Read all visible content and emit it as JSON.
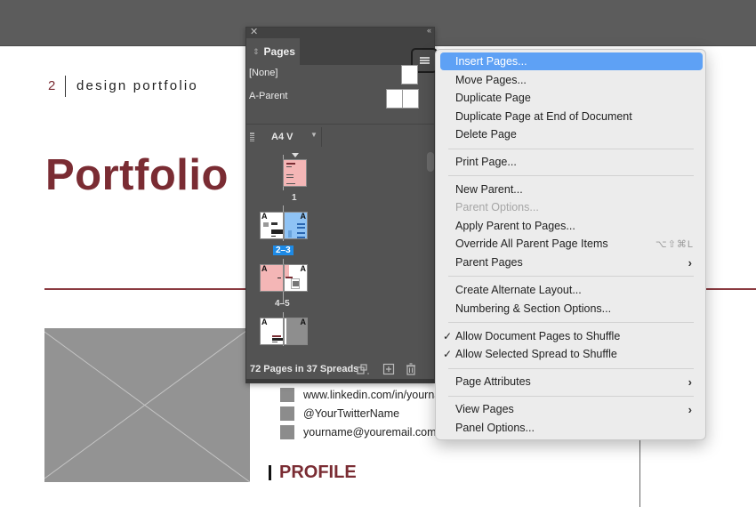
{
  "document": {
    "page_number": "2",
    "header": "design portfolio",
    "title": "Portfolio",
    "contacts": [
      "www.linkedin.com/in/yourname",
      "@YourTwitterName",
      "yourname@youremail.com"
    ],
    "section_heading": "PROFILE",
    "accent_color": "#7a2c33"
  },
  "pages_panel": {
    "close_icon": "close-icon",
    "collapse_icon": "double-chevron-icon",
    "tab_label": "Pages",
    "parents": [
      {
        "label": "[None]"
      },
      {
        "label": "A-Parent"
      }
    ],
    "page_size": "A4 V",
    "spreads": [
      {
        "label": "1",
        "selected": false
      },
      {
        "label": "2–3",
        "selected": true
      },
      {
        "label": "4–5",
        "selected": false
      },
      {
        "label": "",
        "selected": false
      }
    ],
    "parent_marker": "A",
    "footer_status": "72 Pages in 37 Spreads",
    "selection_color": "#1d8ae6"
  },
  "context_menu": {
    "items": [
      {
        "label": "Insert Pages...",
        "highlighted": true
      },
      {
        "label": "Move Pages..."
      },
      {
        "label": "Duplicate Page"
      },
      {
        "label": "Duplicate Page at End of Document"
      },
      {
        "label": "Delete Page"
      },
      {
        "label": "Print Page..."
      },
      {
        "label": "New Parent..."
      },
      {
        "label": "Parent Options...",
        "disabled": true
      },
      {
        "label": "Apply Parent to Pages..."
      },
      {
        "label": "Override All Parent Page Items",
        "shortcut": "⌥⇧⌘L"
      },
      {
        "label": "Parent Pages",
        "submenu": true
      },
      {
        "label": "Create Alternate Layout..."
      },
      {
        "label": "Numbering & Section Options..."
      },
      {
        "label": "Allow Document Pages to Shuffle",
        "checked": true
      },
      {
        "label": "Allow Selected Spread to Shuffle",
        "checked": true
      },
      {
        "label": "Page Attributes",
        "submenu": true
      },
      {
        "label": "View Pages",
        "submenu": true
      },
      {
        "label": "Panel Options..."
      }
    ],
    "check_glyph": "✓",
    "chevron_glyph": "›",
    "highlight_color": "#5ea1f5"
  }
}
